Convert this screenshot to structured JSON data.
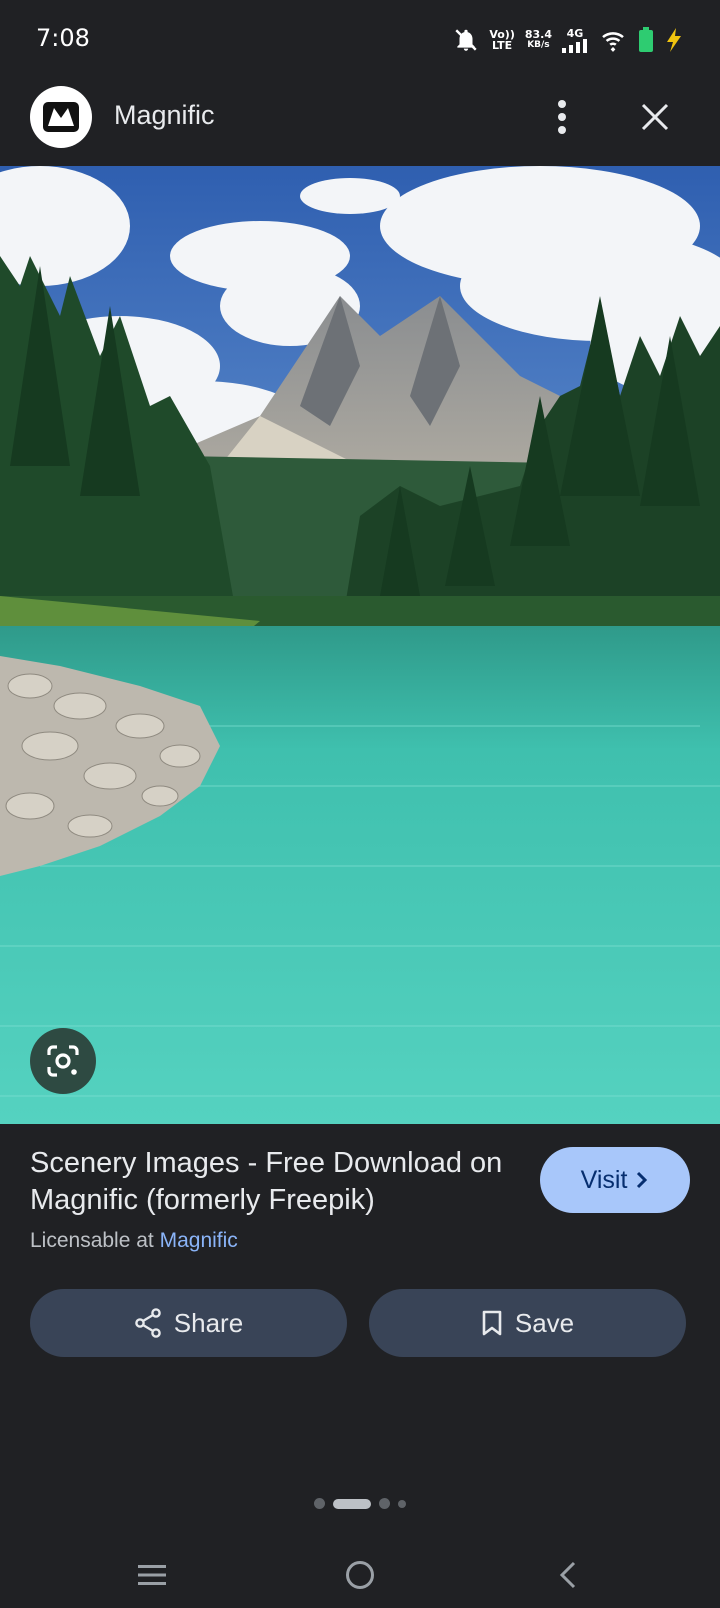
{
  "status": {
    "time": "7:08",
    "volte_top": "Vo))",
    "volte_bottom": "LTE",
    "speed_value": "83.4",
    "speed_unit": "KB/s",
    "network": "4G"
  },
  "header": {
    "site_name": "Magnific"
  },
  "result": {
    "title": "Scenery Images - Free Download on Magnific (formerly Freepik)",
    "license_prefix": "Licensable at",
    "license_link": "Magnific",
    "visit_label": "Visit"
  },
  "actions": {
    "share_label": "Share",
    "save_label": "Save"
  },
  "colors": {
    "background": "#202124",
    "visit_button": "#a8c7fa",
    "action_button": "#394457",
    "link": "#8ab4f8"
  },
  "icons": [
    "mute-icon",
    "signal-icon",
    "wifi-icon",
    "battery-icon",
    "more-vert-icon",
    "close-icon",
    "lens-icon",
    "share-icon",
    "bookmark-icon",
    "chevron-right-icon",
    "menu-icon",
    "home-icon",
    "back-icon"
  ],
  "carousel": {
    "active_index": 1,
    "total": 4
  }
}
